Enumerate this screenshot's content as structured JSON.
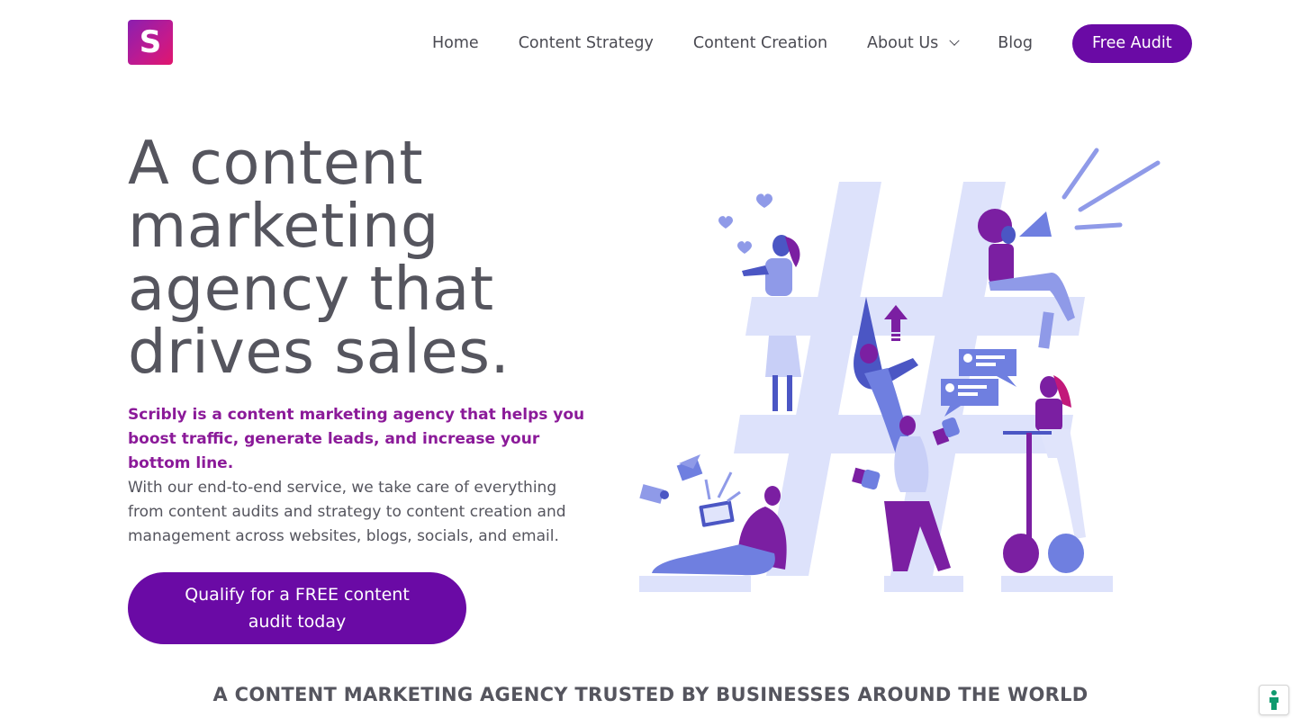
{
  "brand": {
    "logo_letter": "S",
    "logo_icon": "scribly-logo-icon"
  },
  "nav": {
    "items": [
      {
        "label": "Home"
      },
      {
        "label": "Content Strategy"
      },
      {
        "label": "Content Creation"
      },
      {
        "label": "About Us",
        "has_dropdown": true
      },
      {
        "label": "Blog"
      }
    ],
    "cta_label": "Free Audit"
  },
  "hero": {
    "title_lines": [
      "A content",
      "marketing",
      "agency that",
      "drives sales."
    ],
    "lead": "Scribly is a content marketing agency that helps you boost traffic, generate leads, and increase your bottom line.",
    "body": "With our end-to-end service, we take care of everything from content audits and strategy to content creation and management across websites, blogs, socials, and email.",
    "cta_label": "Qualify for a FREE content audit today"
  },
  "trusted_heading": "A CONTENT MARKETING AGENCY TRUSTED BY BUSINESSES AROUND THE WORLD",
  "colors": {
    "brand_purple": "#6a0aa5",
    "lead_purple": "#8b1a99",
    "text_gray": "#55555e",
    "hashtag_light": "#dfe3fb",
    "illus_blue": "#6f7fe0",
    "illus_purple": "#7b1fa2"
  },
  "widgets": {
    "accessibility_icon": "accessibility-icon"
  }
}
